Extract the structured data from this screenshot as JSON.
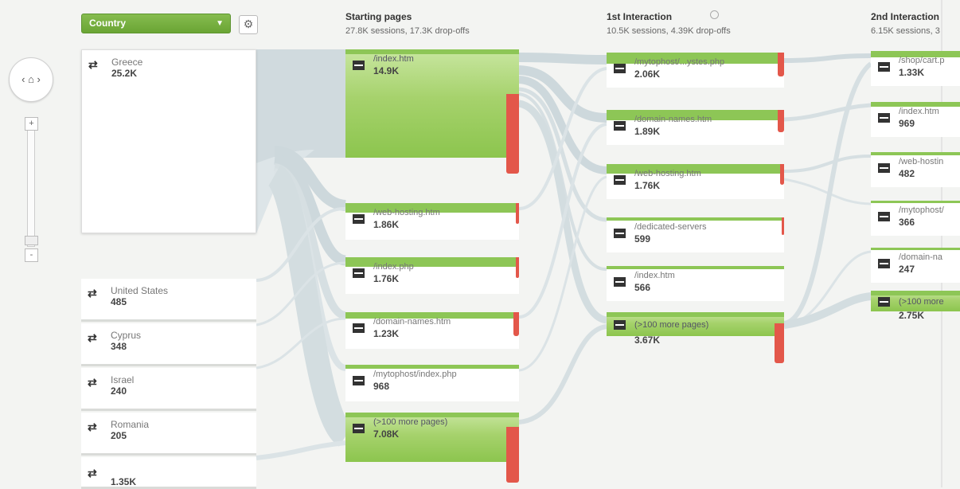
{
  "dimension": {
    "label": "Country"
  },
  "columns": [
    {
      "title": "Starting pages",
      "subtitle": "27.8K sessions, 17.3K drop-offs"
    },
    {
      "title": "1st Interaction",
      "subtitle": "10.5K sessions, 4.39K drop-offs"
    },
    {
      "title": "2nd Interaction",
      "subtitle": "6.15K sessions, 3"
    }
  ],
  "nav": {
    "home_icon": "‹ ⌂ ›",
    "zoom_in": "+",
    "zoom_out": "-"
  },
  "countries": [
    {
      "name": "Greece",
      "value": "25.2K"
    },
    {
      "name": "United States",
      "value": "485"
    },
    {
      "name": "Cyprus",
      "value": "348"
    },
    {
      "name": "Israel",
      "value": "240"
    },
    {
      "name": "Romania",
      "value": "205"
    },
    {
      "name": "",
      "value": "1.35K"
    }
  ],
  "starting_pages": [
    {
      "name": "/index.htm",
      "value": "14.9K"
    },
    {
      "name": "/web-hosting.htm",
      "value": "1.86K"
    },
    {
      "name": "/index.php",
      "value": "1.76K"
    },
    {
      "name": "/domain-names.htm",
      "value": "1.23K"
    },
    {
      "name": "/mytophost/index.php",
      "value": "968"
    },
    {
      "name": "(>100 more pages)",
      "value": "7.08K"
    }
  ],
  "first_interaction": [
    {
      "name": "/mytophost/...ystes.php",
      "value": "2.06K"
    },
    {
      "name": "/domain-names.htm",
      "value": "1.89K"
    },
    {
      "name": "/web-hosting.htm",
      "value": "1.76K"
    },
    {
      "name": "/dedicated-servers",
      "value": "599"
    },
    {
      "name": "/index.htm",
      "value": "566"
    },
    {
      "name": "(>100 more pages)",
      "value": "3.67K"
    }
  ],
  "second_interaction": [
    {
      "name": "/shop/cart.p",
      "value": "1.33K"
    },
    {
      "name": "/index.htm",
      "value": "969"
    },
    {
      "name": "/web-hostin",
      "value": "482"
    },
    {
      "name": "/mytophost/",
      "value": "366"
    },
    {
      "name": "/domain-na",
      "value": "247"
    },
    {
      "name": "(>100 more",
      "value": "2.75K"
    }
  ],
  "colors": {
    "node_green": "#8dc656",
    "drop_red": "#e3574a",
    "flow_grey": "#cdd8dc"
  }
}
